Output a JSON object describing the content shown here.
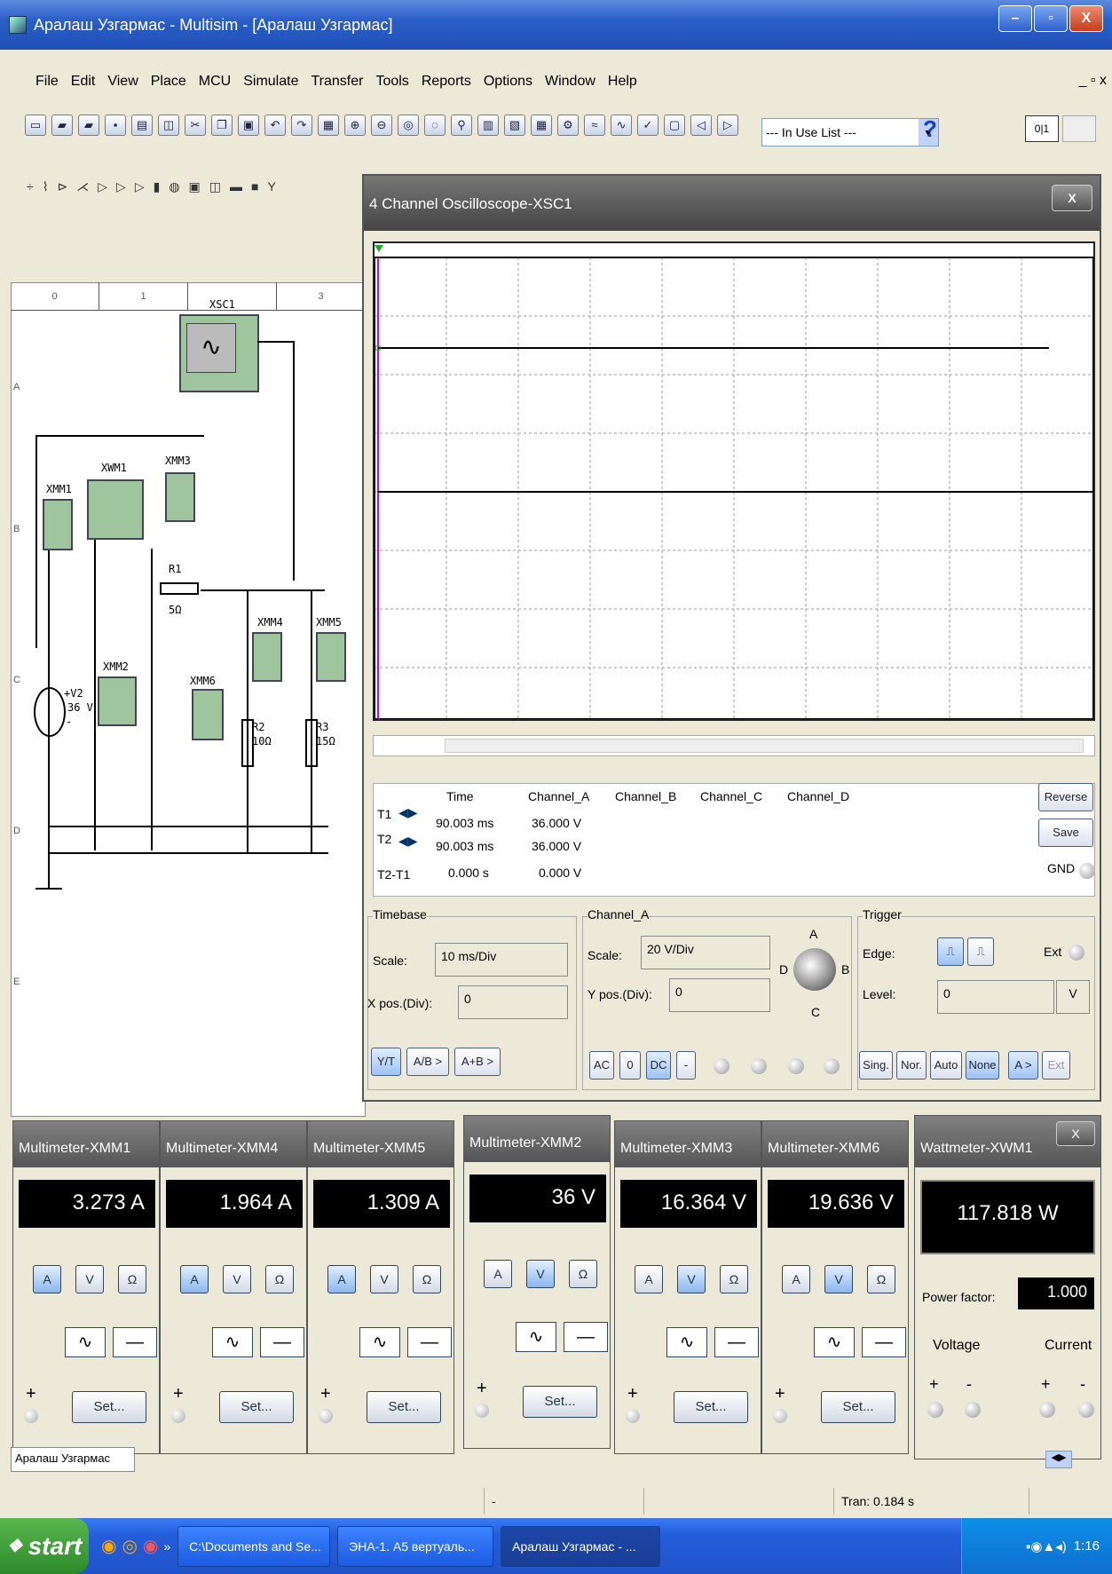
{
  "window": {
    "title": "Аралаш Узгармас - Multisim - [Аралаш Узгармас]"
  },
  "menu": [
    "File",
    "Edit",
    "View",
    "Place",
    "MCU",
    "Simulate",
    "Transfer",
    "Tools",
    "Reports",
    "Options",
    "Window",
    "Help"
  ],
  "mdi_controls": "_ ▫ x",
  "toolbar": {
    "in_use_list": "--- In Use List ---",
    "help_glyph": "?"
  },
  "ruler": [
    "0",
    "1",
    "",
    "3"
  ],
  "rows": [
    "A",
    "B",
    "C",
    "D",
    "E"
  ],
  "schematic": {
    "xsc": "XSC1",
    "xwm": "XWM1",
    "meters": [
      "XMM1",
      "XMM3",
      "XMM4",
      "XMM5",
      "XMM2",
      "XMM6"
    ],
    "r1": "R1",
    "r1v": "5Ω",
    "r2": "R2",
    "r2v": "10Ω",
    "r3": "R3",
    "r3v": "15Ω",
    "v2": "+V2",
    "v2v": "36 V",
    "v2minus": "-"
  },
  "oscilloscope": {
    "title": "4 Channel Oscilloscope-XSC1",
    "close": "X",
    "readout": {
      "headers": [
        "Time",
        "Channel_A",
        "Channel_B",
        "Channel_C",
        "Channel_D"
      ],
      "rows": [
        {
          "label": "T1",
          "time": "90.003 ms",
          "a": "36.000 V"
        },
        {
          "label": "T2",
          "time": "90.003 ms",
          "a": "36.000 V"
        },
        {
          "label": "T2-T1",
          "time": "0.000 s",
          "a": "0.000 V"
        }
      ]
    },
    "reverse": "Reverse",
    "save": "Save",
    "gnd": "GND",
    "timebase": {
      "title": "Timebase",
      "scale_label": "Scale:",
      "scale": "10 ms/Div",
      "xpos_label": "X pos.(Div):",
      "xpos": "0",
      "btns": [
        "Y/T",
        "A/B >",
        "A+B >"
      ]
    },
    "channel": {
      "title": "Channel_A",
      "scale_label": "Scale:",
      "scale": "20  V/Div",
      "ypos_label": "Y pos.(Div):",
      "ypos": "0",
      "btns": [
        "AC",
        "0",
        "DC",
        "-"
      ],
      "knob": [
        "A",
        "B",
        "C",
        "D"
      ]
    },
    "trigger": {
      "title": "Trigger",
      "edge_label": "Edge:",
      "ext": "Ext",
      "level_label": "Level:",
      "level": "0",
      "unit": "V",
      "btns": [
        "Sing.",
        "Nor.",
        "Auto",
        "None",
        "A >",
        "Ext"
      ]
    }
  },
  "multimeters": [
    {
      "title": "Multimeter-XMM1",
      "value": "3.273 A",
      "mode": "A"
    },
    {
      "title": "Multimeter-XMM4",
      "value": "1.964 A",
      "mode": "A"
    },
    {
      "title": "Multimeter-XMM5",
      "value": "1.309 A",
      "mode": "A"
    },
    {
      "title": "Multimeter-XMM2",
      "value": "36 V",
      "mode": "V"
    },
    {
      "title": "Multimeter-XMM3",
      "value": "16.364 V",
      "mode": "V"
    },
    {
      "title": "Multimeter-XMM6",
      "value": "19.636 V",
      "mode": "V"
    }
  ],
  "mm_labels": {
    "a": "A",
    "v": "V",
    "o": "Ω",
    "set": "Set...",
    "plus": "+"
  },
  "wattmeter": {
    "title": "Wattmeter-XWM1",
    "value": "117.818 W",
    "pf_label": "Power factor:",
    "pf": "1.000",
    "voltage": "Voltage",
    "current": "Current",
    "plus": "+",
    "minus": "-",
    "close": "X"
  },
  "tab": "Аралаш Узгармас",
  "status": {
    "mid": "-",
    "tran": "Tran: 0.184 s"
  },
  "taskbar": {
    "start": "start",
    "tasks": [
      "C:\\Documents and Se...",
      "ЭНА-1. А5 вертуаль...",
      "Аралаш Узгармас - ..."
    ],
    "time": "1:16"
  }
}
